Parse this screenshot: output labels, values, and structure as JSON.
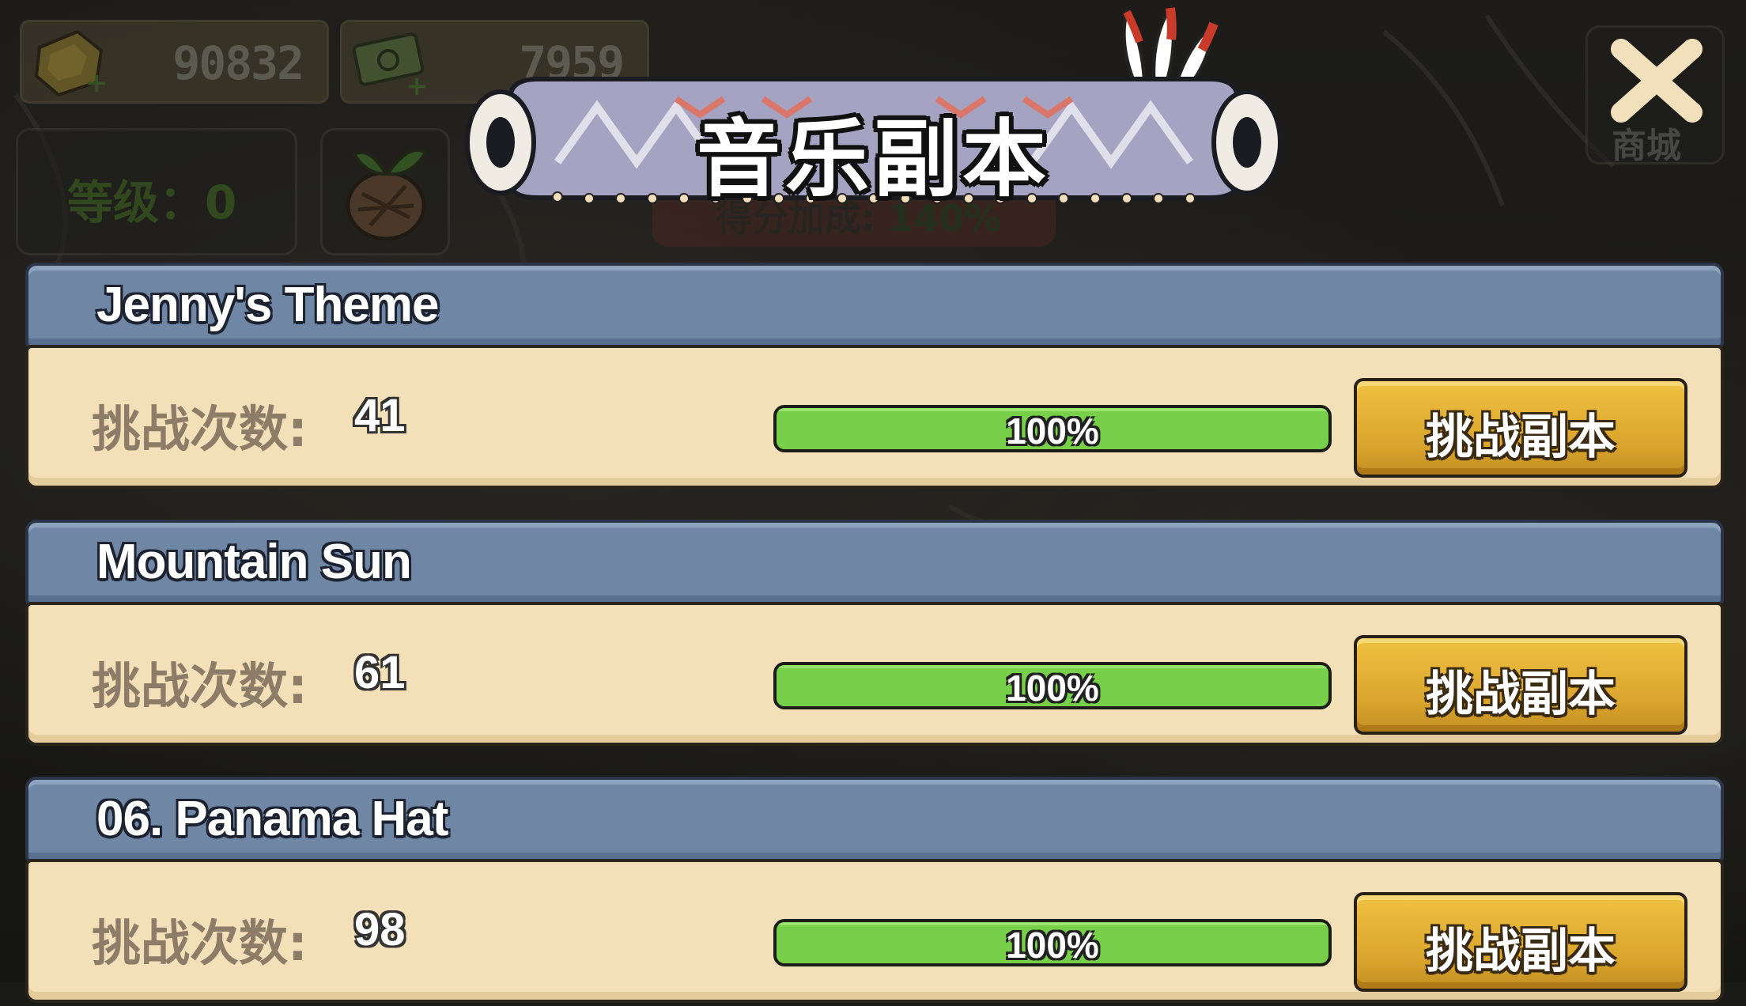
{
  "header": {
    "currencies": [
      {
        "icon": "gold-block-icon",
        "value": "90832"
      },
      {
        "icon": "cash-stack-icon",
        "value": "7959"
      }
    ],
    "level_text": "等级：0",
    "bonus_label": "得分加成:",
    "bonus_value": "140%",
    "title": "音乐副本",
    "shop_label": "商城"
  },
  "songs": [
    {
      "title": "Jenny's Theme",
      "attempts_label": "挑战次数:",
      "attempts": "41",
      "progress_percent": 100,
      "progress_text": "100%",
      "button_label": "挑战副本"
    },
    {
      "title": "Mountain Sun",
      "attempts_label": "挑战次数:",
      "attempts": "61",
      "progress_percent": 100,
      "progress_text": "100%",
      "button_label": "挑战副本"
    },
    {
      "title": "06. Panama Hat",
      "attempts_label": "挑战次数:",
      "attempts": "98",
      "progress_percent": 100,
      "progress_text": "100%",
      "button_label": "挑战副本"
    }
  ],
  "colors": {
    "card_header": "#6f87a4",
    "card_body": "#f3dfb8",
    "progress_fill": "#78d04a",
    "button_gold": "#e0aa30"
  }
}
